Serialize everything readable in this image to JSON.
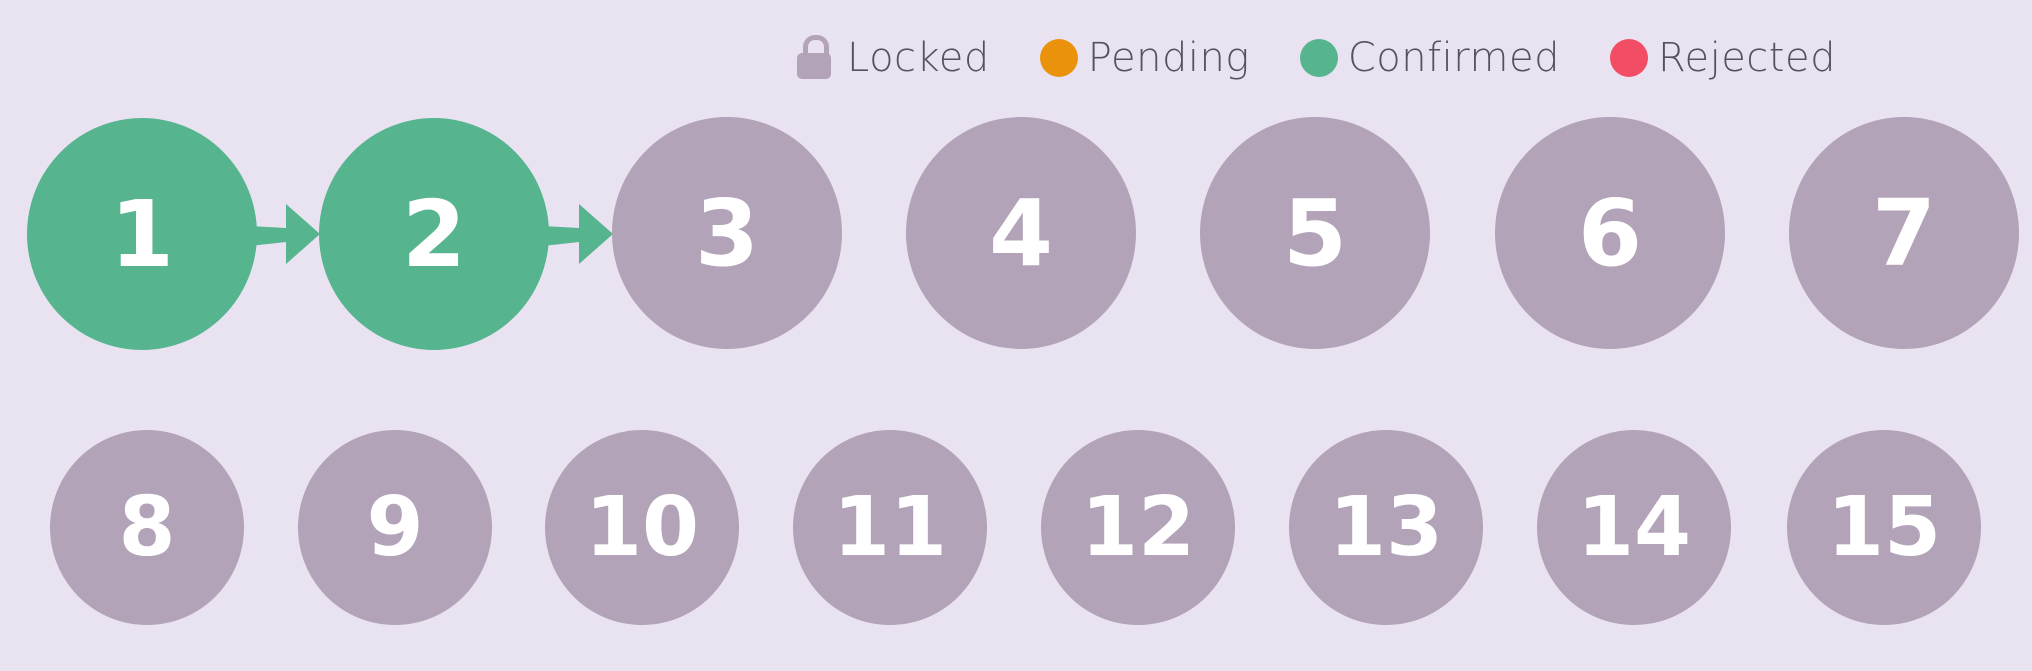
{
  "colors": {
    "background": "#e9e3f1",
    "locked": "#b2a3b8",
    "pending": "#ea920c",
    "confirmed": "#56b48f",
    "rejected": "#f34d65",
    "text": "#55535a"
  },
  "legend": [
    {
      "key": "locked",
      "label": "Locked",
      "icon": "lock-icon"
    },
    {
      "key": "pending",
      "label": "Pending",
      "icon": "dot-icon"
    },
    {
      "key": "confirmed",
      "label": "Confirmed",
      "icon": "dot-icon"
    },
    {
      "key": "rejected",
      "label": "Rejected",
      "icon": "dot-icon"
    }
  ],
  "steps": [
    {
      "label": "1",
      "status": "confirmed"
    },
    {
      "label": "2",
      "status": "confirmed"
    },
    {
      "label": "3",
      "status": "locked"
    },
    {
      "label": "4",
      "status": "locked"
    },
    {
      "label": "5",
      "status": "locked"
    },
    {
      "label": "6",
      "status": "locked"
    },
    {
      "label": "7",
      "status": "locked"
    },
    {
      "label": "8",
      "status": "locked"
    },
    {
      "label": "9",
      "status": "locked"
    },
    {
      "label": "10",
      "status": "locked"
    },
    {
      "label": "11",
      "status": "locked"
    },
    {
      "label": "12",
      "status": "locked"
    },
    {
      "label": "13",
      "status": "locked"
    },
    {
      "label": "14",
      "status": "locked"
    },
    {
      "label": "15",
      "status": "locked"
    }
  ],
  "connections": [
    {
      "from": "1",
      "to": "2"
    },
    {
      "from": "2",
      "to": "3"
    }
  ]
}
